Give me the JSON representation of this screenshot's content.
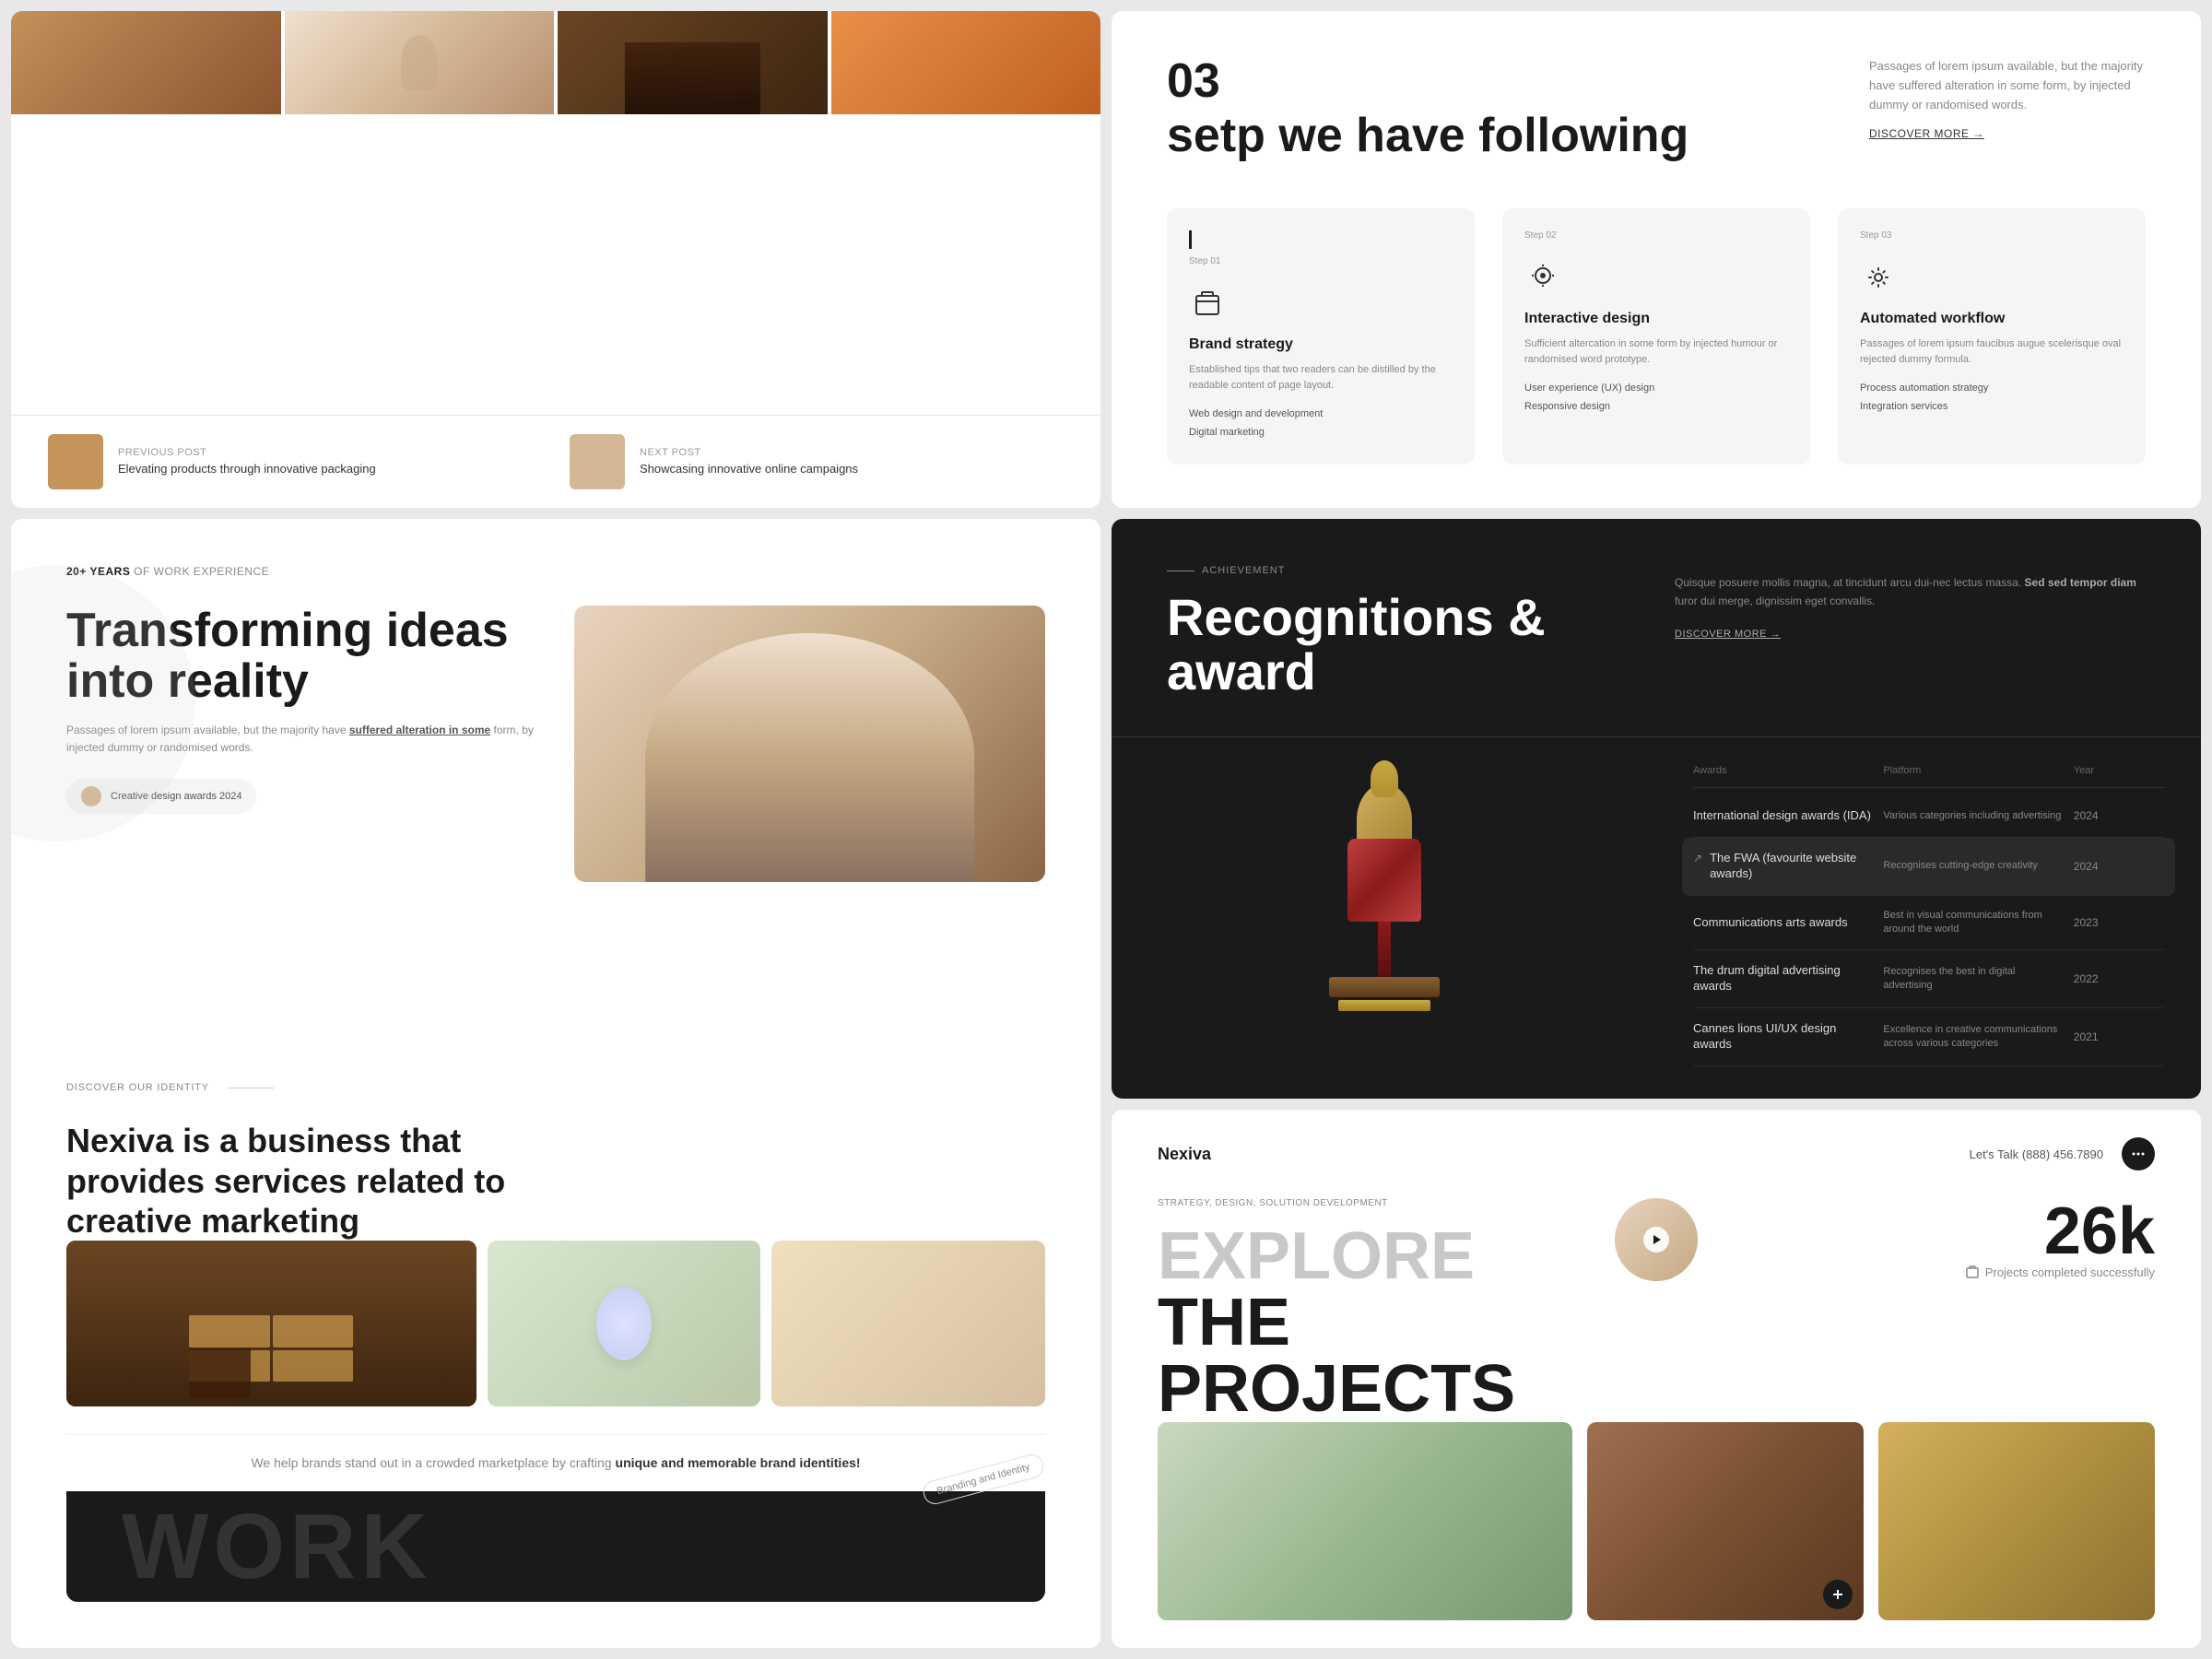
{
  "topLeft": {
    "postNav": {
      "previousLabel": "PREVIOUS POST",
      "nextLabel": "NEXT POST",
      "prevTitle": "Elevating products through innovative packaging",
      "nextTitle": "Showcasing innovative online campaigns"
    }
  },
  "topRight": {
    "stepNumber": "03",
    "stepTitle": "setp we have following",
    "description": "Passages of lorem ipsum available, but the majority have suffered alteration in some form, by injected dummy or randomised words.",
    "discoverMore": "DISCOVER MORE →",
    "steps": [
      {
        "number": "Step 01",
        "title": "Brand strategy",
        "description": "Established tips that two readers can be distilled by the readable content of page layout.",
        "features": "Web design and development\nDigital marketing",
        "iconType": "box"
      },
      {
        "number": "Step 02",
        "title": "Interactive design",
        "description": "Sufficient altercation in some form by injected humour or randomised word prototype.",
        "features": "User experience (UX) design\nResponsive design",
        "iconType": "cursor"
      },
      {
        "number": "Step 03",
        "title": "Automated workflow",
        "description": "Passages of lorem ipsum faucibus augue scelerisque oval rejected dummy formula.",
        "features": "Process automation strategy\nIntegration services",
        "iconType": "gear"
      }
    ]
  },
  "bottomLeft": {
    "yearsLabel": "20+ YEARS",
    "yearsSubLabel": "OF WORK EXPERIENCE",
    "mainTitle": "Transforming ideas into reality",
    "description": "Passages of lorem ipsum available, but the majority have suffered alteration in some form, by injected dummy or randomised words.",
    "awardBadge": "Creative design awards 2024",
    "discoverIdentity": "DISCOVER OUR IDENTITY",
    "tagline": "Nexiva is a business that provides services related to creative marketing",
    "brandTagline": "We help brands stand out in a crowded marketplace by crafting",
    "brandTaglineStrong": "unique and memorable brand identities!",
    "brandingTag": "Branding and Identity",
    "workText": "WORK"
  },
  "bottomRightDark": {
    "achievementLabel": "ACHIEVEMENT",
    "title": "Recognitions & award",
    "description": "Quisque posuere mollis magna, at tincidunt arcu dui-nec lectus massa. Sed sed tempor diam furor dui merge, dignissim eget convallis.",
    "discoverMore": "DISCOVER MORE →",
    "tableHeaders": {
      "awards": "Awards",
      "platform": "Platform",
      "year": "Year"
    },
    "awards": [
      {
        "name": "International design awards (IDA)",
        "platform": "Various categories including advertising",
        "year": "2024",
        "highlighted": false
      },
      {
        "name": "The FWA (favourite website awards)",
        "platform": "Recognises cutting-edge creativity",
        "year": "2024",
        "highlighted": true
      },
      {
        "name": "Communications arts awards",
        "platform": "Best in visual communications from around the world",
        "year": "2023",
        "highlighted": false
      },
      {
        "name": "The drum digital advertising awards",
        "platform": "Recognises the best in digital advertising",
        "year": "2022",
        "highlighted": false
      },
      {
        "name": "Cannes lions UI/UX design awards",
        "platform": "Excellence in creative communications across various categories",
        "year": "2021",
        "highlighted": false
      }
    ]
  },
  "nexiva": {
    "logo": "Nexiva",
    "letsTalk": "Let's Talk",
    "phone": "(888) 456.7890",
    "strategyLabel": "STRATEGY, DESIGN, SOLUTION DEVELOPMENT",
    "exploreText": "EXPLORE",
    "theText": " THE",
    "projectsText": "PROJECTS",
    "statNumber": "26k",
    "statLabel": "Projects completed successfully"
  }
}
